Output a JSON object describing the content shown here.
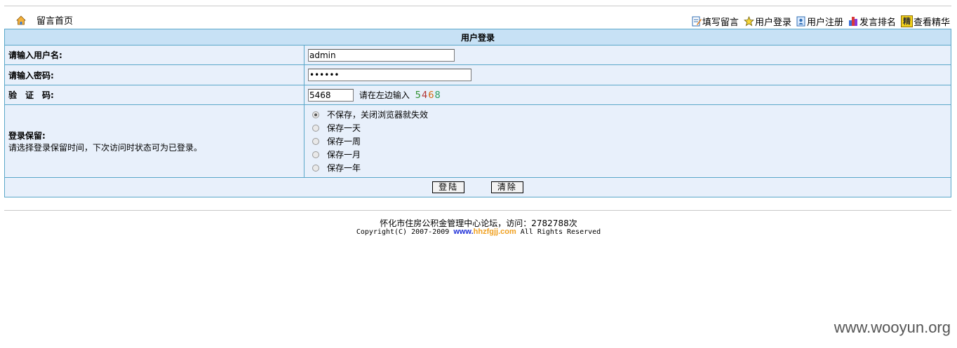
{
  "topbar": {
    "home_label": "留言首页",
    "nav": [
      {
        "label": "填写留言",
        "icon": "write-icon"
      },
      {
        "label": "用户登录",
        "icon": "star-icon"
      },
      {
        "label": "用户注册",
        "icon": "register-icon"
      },
      {
        "label": "发言排名",
        "icon": "ranking-icon"
      },
      {
        "label": "查看精华",
        "icon": "essence-icon",
        "icon_text": "精"
      }
    ]
  },
  "form": {
    "title": "用户登录",
    "username_label": "请输入用户名:",
    "username_value": "admin",
    "password_label": "请输入密码:",
    "password_value": "••••••",
    "captcha_label": "验　证　码:",
    "captcha_value": "5468",
    "captcha_hint": "请在左边输入",
    "captcha_digits": [
      "5",
      "4",
      "6",
      "8"
    ],
    "keep_title": "登录保留:",
    "keep_desc": "请选择登录保留时间，下次访问时状态可为已登录。",
    "keep_options": [
      "不保存，关闭浏览器就失效",
      "保存一天",
      "保存一周",
      "保存一月",
      "保存一年"
    ],
    "keep_selected": 0,
    "login_button": "登陆",
    "clear_button": "清除"
  },
  "footer": {
    "line1": "怀化市住房公积金管理中心论坛，访问：2782788次",
    "copyright": "Copyright(C) 2007-2009",
    "www": "www.",
    "domain": "hhzfgjj.com",
    "rights": "All Rights Reserved"
  },
  "watermark": "www.wooyun.org"
}
